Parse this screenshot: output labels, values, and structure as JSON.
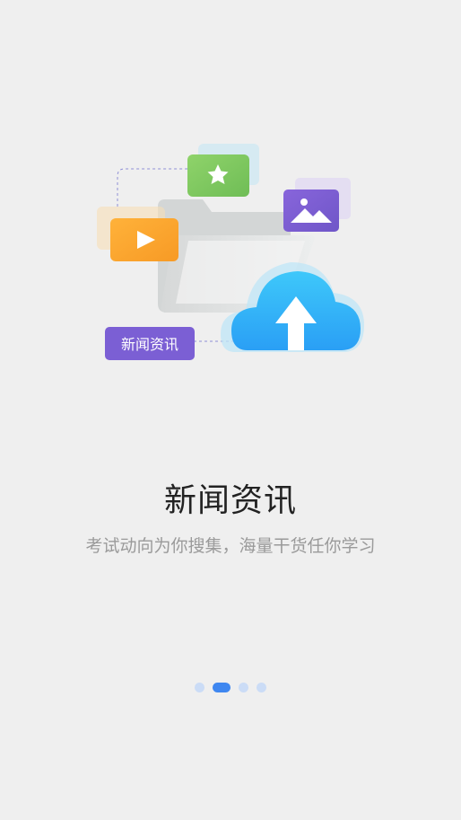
{
  "illustration": {
    "badge_label": "新闻资讯"
  },
  "headline": "新闻资讯",
  "subtitle": "考试动向为你搜集，海量干货任你学习",
  "pager": {
    "count": 4,
    "active_index": 1
  },
  "colors": {
    "background": "#efefef",
    "accent": "#3f87f0",
    "badge": "#7b5fd4",
    "video_card": "#f6a623",
    "star_card": "#7fc65f",
    "image_card": "#7b5fd4",
    "cloud": "#34b3f5"
  }
}
